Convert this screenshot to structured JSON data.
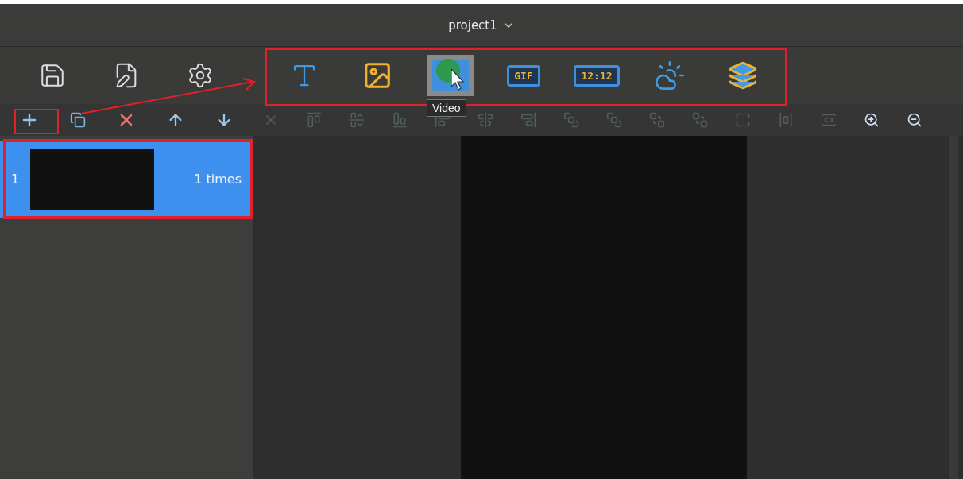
{
  "window": {
    "title": "project1"
  },
  "file_tools": [
    {
      "kind": "save"
    },
    {
      "kind": "save-as"
    },
    {
      "kind": "settings"
    }
  ],
  "media_tools": [
    {
      "kind": "text",
      "hovered": false
    },
    {
      "kind": "image",
      "hovered": false
    },
    {
      "kind": "video",
      "hovered": true,
      "tooltip": "Video"
    },
    {
      "kind": "gif",
      "hovered": false,
      "label": "GIF"
    },
    {
      "kind": "clock",
      "hovered": false,
      "label": "12:12"
    },
    {
      "kind": "weather",
      "hovered": false
    },
    {
      "kind": "layers",
      "hovered": false
    }
  ],
  "program_tools": [
    {
      "kind": "add"
    },
    {
      "kind": "copy"
    },
    {
      "kind": "delete"
    },
    {
      "kind": "up"
    },
    {
      "kind": "down"
    }
  ],
  "edit_tools": [
    {
      "kind": "delete",
      "disabled": true
    },
    {
      "kind": "align-top",
      "disabled": true
    },
    {
      "kind": "align-middle",
      "disabled": true
    },
    {
      "kind": "align-bottom",
      "disabled": true
    },
    {
      "kind": "align-left",
      "disabled": true
    },
    {
      "kind": "align-center",
      "disabled": true
    },
    {
      "kind": "align-right",
      "disabled": true
    },
    {
      "kind": "front",
      "disabled": true
    },
    {
      "kind": "forward",
      "disabled": true
    },
    {
      "kind": "backward",
      "disabled": true
    },
    {
      "kind": "back",
      "disabled": true
    },
    {
      "kind": "fit",
      "disabled": true
    },
    {
      "kind": "space-h",
      "disabled": true
    },
    {
      "kind": "space-v",
      "disabled": true
    },
    {
      "kind": "zoom-in",
      "disabled": false
    },
    {
      "kind": "zoom-out",
      "disabled": false
    }
  ],
  "programs": [
    {
      "number": "1",
      "repeat": "1 times",
      "selected": true
    }
  ]
}
